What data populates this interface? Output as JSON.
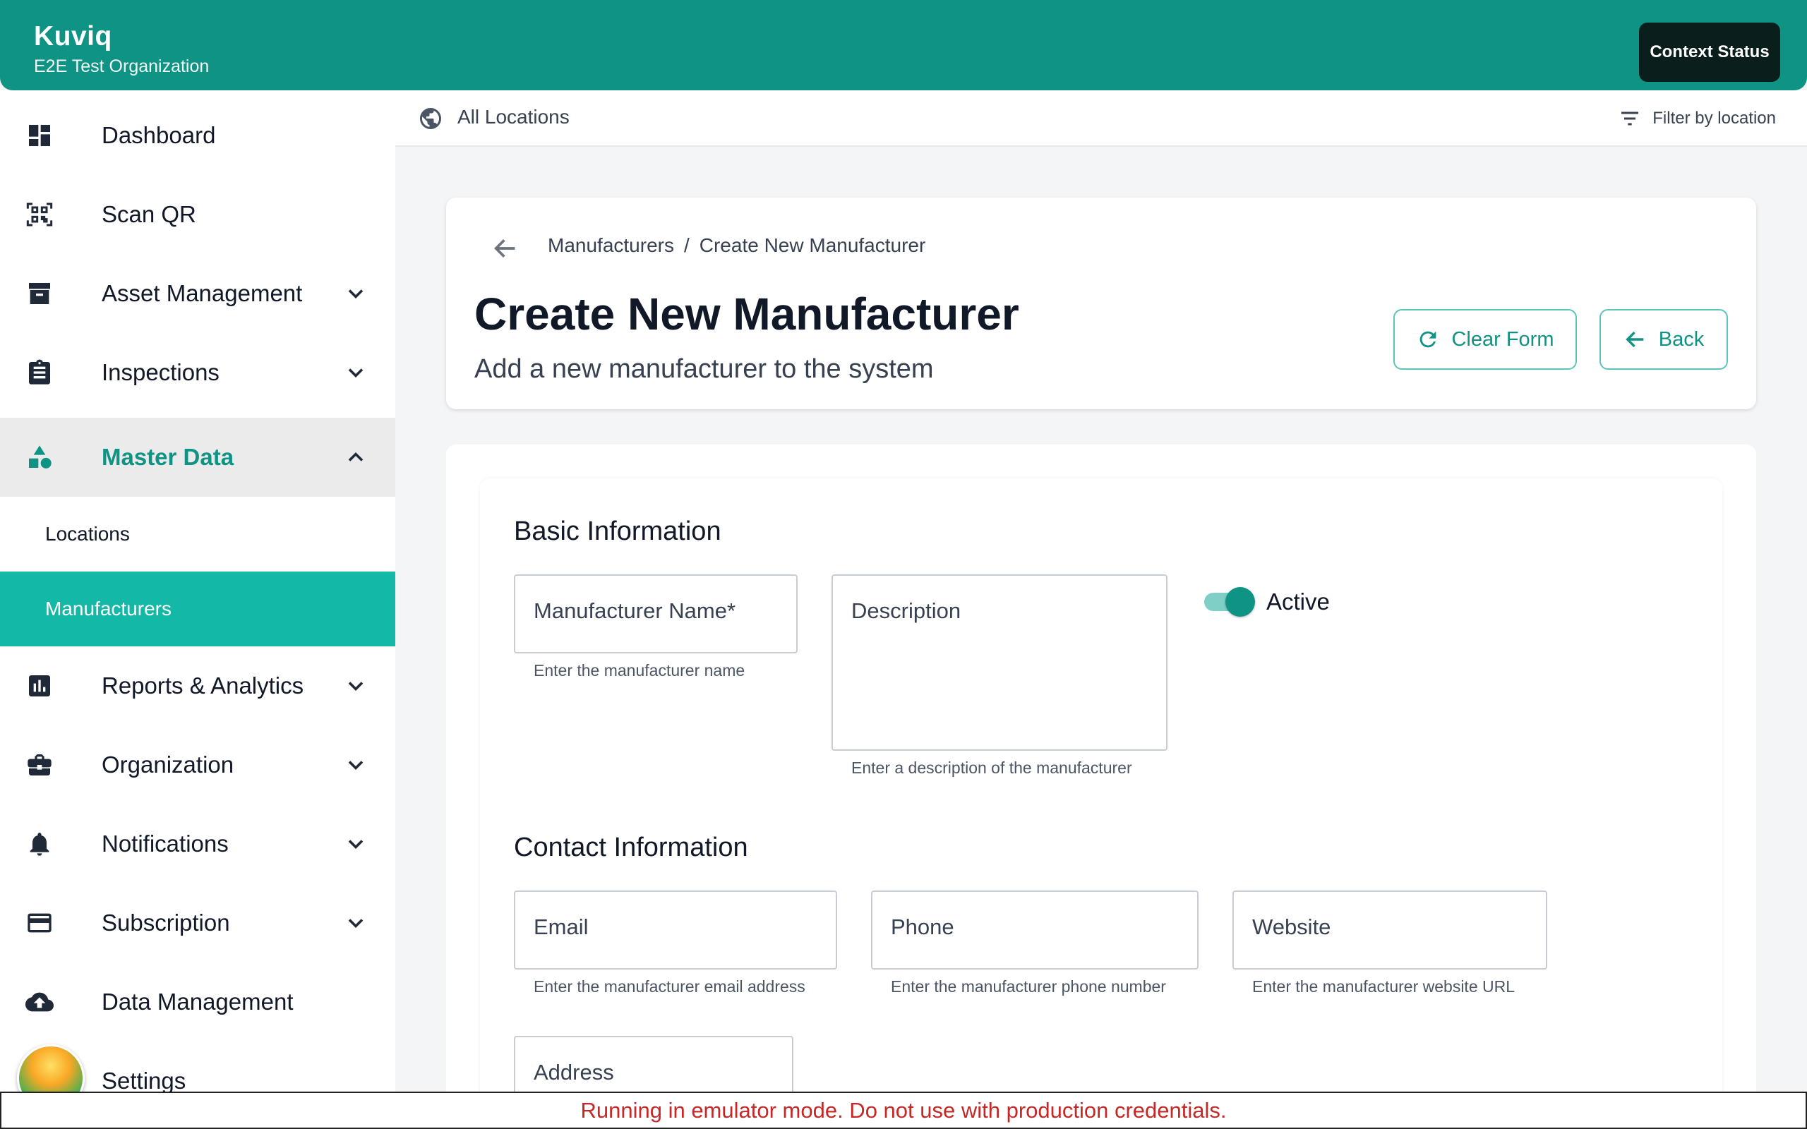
{
  "app": {
    "name": "Kuviq",
    "organization": "E2E Test Organization",
    "context_button": "Context Status"
  },
  "sidebar": {
    "items": [
      {
        "label": "Dashboard",
        "icon": "dashboard-icon"
      },
      {
        "label": "Scan QR",
        "icon": "qr-scan-icon"
      },
      {
        "label": "Asset Management",
        "icon": "archive-box-icon",
        "expandable": true
      },
      {
        "label": "Inspections",
        "icon": "clipboard-icon",
        "expandable": true
      },
      {
        "label": "Master Data",
        "icon": "shapes-icon",
        "expandable": true,
        "expanded": true
      },
      {
        "label": "Reports & Analytics",
        "icon": "bar-chart-icon",
        "expandable": true
      },
      {
        "label": "Organization",
        "icon": "briefcase-icon",
        "expandable": true
      },
      {
        "label": "Notifications",
        "icon": "bell-icon",
        "expandable": true
      },
      {
        "label": "Subscription",
        "icon": "credit-card-icon",
        "expandable": true
      },
      {
        "label": "Data Management",
        "icon": "cloud-upload-icon"
      },
      {
        "label": "Settings",
        "icon": "gear-icon"
      }
    ],
    "master_data_children": [
      {
        "label": "Locations"
      },
      {
        "label": "Manufacturers",
        "selected": true
      }
    ]
  },
  "location_bar": {
    "label": "All Locations",
    "filter_label": "Filter by location"
  },
  "header": {
    "breadcrumb": [
      "Manufacturers",
      "/",
      "Create New Manufacturer"
    ],
    "title": "Create New Manufacturer",
    "subtitle": "Add a new manufacturer to the system",
    "clear_label": "Clear Form",
    "back_label": "Back"
  },
  "form": {
    "basic_title": "Basic Information",
    "name_placeholder": "Manufacturer Name*",
    "name_helper": "Enter the manufacturer name",
    "description_placeholder": "Description",
    "description_helper": "Enter a description of the manufacturer",
    "active_label": "Active",
    "active_value": true,
    "contact_title": "Contact Information",
    "email_placeholder": "Email",
    "email_helper": "Enter the manufacturer email address",
    "phone_placeholder": "Phone",
    "phone_helper": "Enter the manufacturer phone number",
    "website_placeholder": "Website",
    "website_helper": "Enter the manufacturer website URL",
    "address_placeholder": "Address"
  },
  "banner": {
    "text": "Running in emulator mode. Do not use with production credentials."
  },
  "colors": {
    "primary": "#0e9384",
    "selected_nav": "#14b8a6",
    "banner_text": "#c62828"
  }
}
